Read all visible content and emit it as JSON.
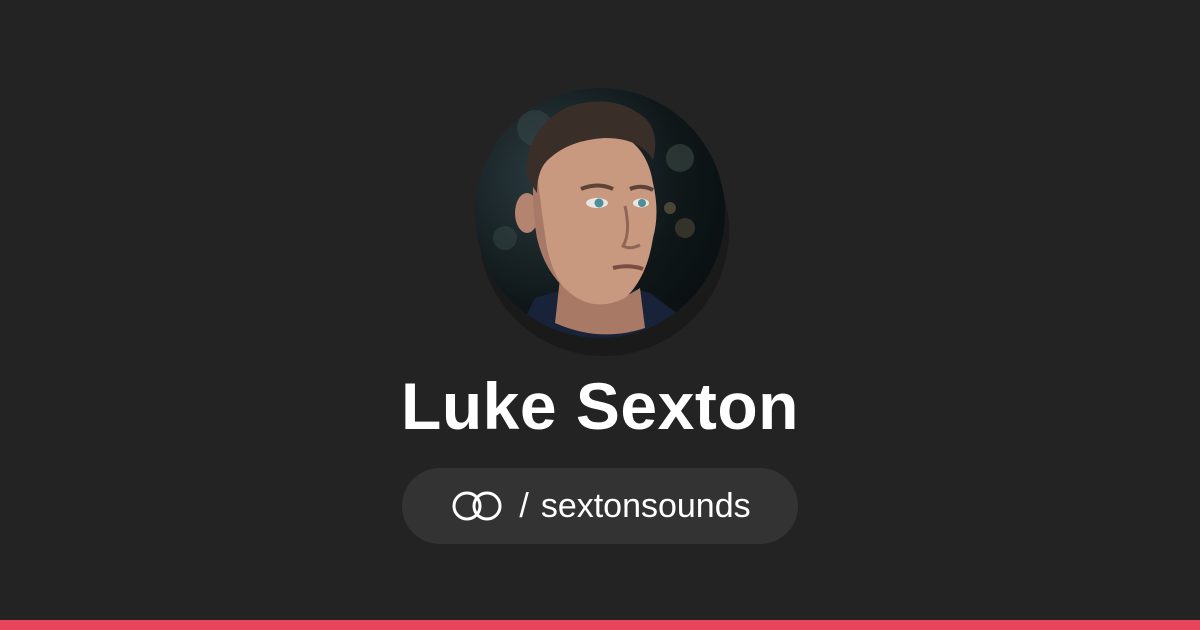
{
  "profile": {
    "name": "Luke Sexton",
    "handle_separator": "/",
    "handle": "sextonsounds"
  },
  "icons": {
    "link": "linktree-link-icon",
    "avatar": "profile-photo"
  },
  "colors": {
    "background": "#232323",
    "pill": "#333333",
    "text": "#ffffff",
    "accent": "#e8455c"
  }
}
